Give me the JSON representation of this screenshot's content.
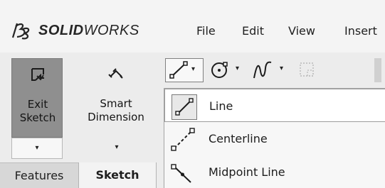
{
  "app": {
    "brand_prefix": "SOLID",
    "brand_suffix": "WORKS",
    "logo_icon": "ds-logo-icon"
  },
  "menu": {
    "items": [
      {
        "label": "File"
      },
      {
        "label": "Edit"
      },
      {
        "label": "View"
      },
      {
        "label": "Insert"
      }
    ]
  },
  "command_manager": {
    "exit_sketch": {
      "line1": "Exit",
      "line2": "Sketch",
      "icon": "exit-sketch-icon",
      "dropdown_glyph": "▾"
    },
    "smart_dimension": {
      "line1": "Smart",
      "line2": "Dimension",
      "icon": "smart-dimension-icon",
      "dropdown_glyph": "▾"
    }
  },
  "tabs": [
    {
      "label": "Features",
      "active": false
    },
    {
      "label": "Sketch",
      "active": true
    }
  ],
  "toolbar": {
    "tools": [
      {
        "name": "line-tool",
        "icon": "line-icon",
        "dropdown": "▾"
      },
      {
        "name": "circle-tool",
        "icon": "circle-icon",
        "dropdown": "▾"
      },
      {
        "name": "spline-tool",
        "icon": "spline-icon",
        "dropdown": "▾"
      },
      {
        "name": "rectangle-tool",
        "icon": "rectangle-icon"
      }
    ]
  },
  "line_dropdown": {
    "items": [
      {
        "label": "Line",
        "icon": "line-icon",
        "selected": true
      },
      {
        "label": "Centerline",
        "icon": "centerline-icon",
        "selected": false
      },
      {
        "label": "Midpoint Line",
        "icon": "midpoint-line-icon",
        "selected": false
      }
    ]
  },
  "colors": {
    "background": "#efefef",
    "active_button": "#8f8f8f",
    "selected_item": "#ffffff",
    "text": "#1e1e1e"
  }
}
